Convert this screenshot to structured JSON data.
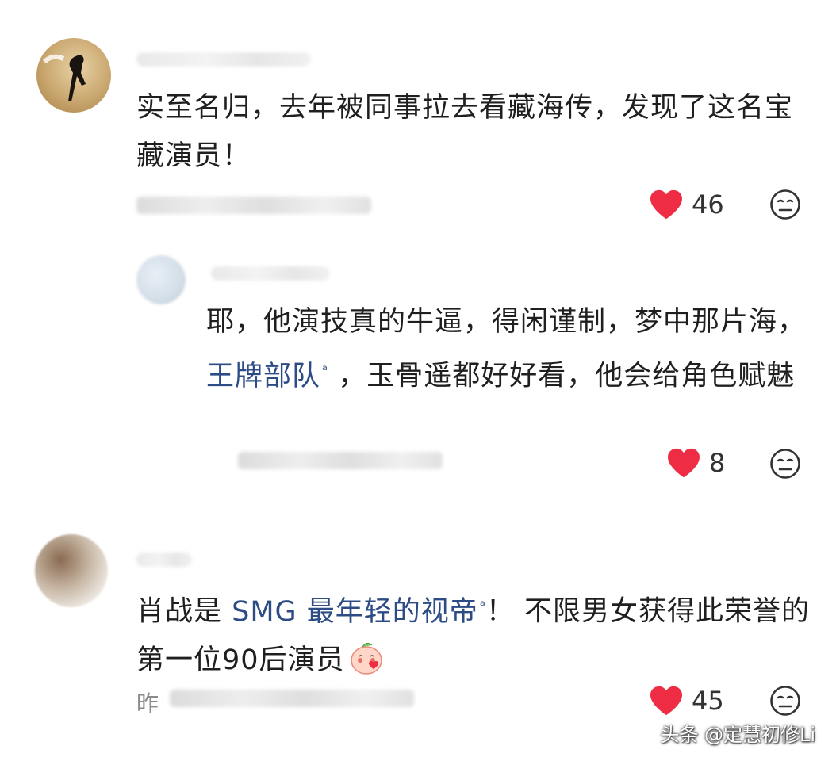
{
  "comments": [
    {
      "text": "实至名归，去年被同事拉去看藏海传，发现了这名宝藏演员！",
      "like_count": "46",
      "like_icon": "heart-icon",
      "react_icon": "neutral-face-icon",
      "reply": {
        "text_before": "耶，他演技真的牛逼，得闲谨制，梦中那片海，",
        "link": "王牌部队",
        "text_after": "，玉骨遥都好好看，他会给角色赋魅",
        "like_count": "8"
      }
    },
    {
      "text_before": "肖战是 ",
      "link": "SMG 最年轻的视帝",
      "text_after": "！ 不限男女获得此荣誉的第一位90后演员",
      "emoji": "shy-peach-emoji",
      "like_count": "45",
      "meta_visible": "昨"
    }
  ],
  "search_mark": "ᵃ",
  "watermark": "头条 @定慧初修Li",
  "colors": {
    "heart": "#ee2c43",
    "link": "#2d4c86",
    "text": "#1f1f1f",
    "muted": "#999999"
  }
}
